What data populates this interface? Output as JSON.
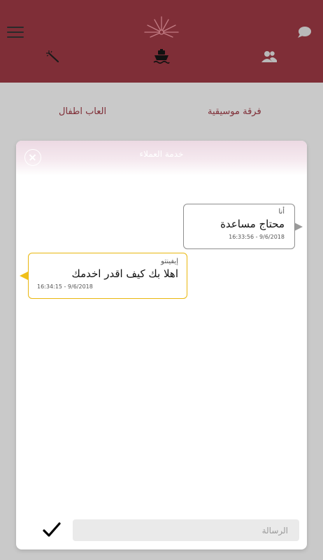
{
  "header": {
    "menu_icon": "hamburger-icon",
    "logo_icon": "fireworks-logo",
    "chat_icon": "chat-bubble-icon",
    "wand_icon": "magic-wand-icon",
    "ship_icon": "ship-icon",
    "users_icon": "users-icon"
  },
  "categories": {
    "left": "العاب اطفال",
    "right": "فرقة موسيقية"
  },
  "chat": {
    "title": "خدمة العملاء",
    "close_icon": "close-icon",
    "messages": [
      {
        "sender": "أنا",
        "text": "محتاج مساعدة",
        "time": "16:33:56 - 9/6/2018"
      },
      {
        "sender": "إيفينتو",
        "text": "اهلا بك كيف اقدر اخدمك",
        "time": "16:34:15 - 9/6/2018"
      }
    ],
    "input_placeholder": "الرسالة",
    "send_icon": "checkmark-icon"
  },
  "colors": {
    "header_bg": "#7f2e37",
    "accent_yellow": "#e9b70d",
    "overlay": "#c9c9c9"
  }
}
